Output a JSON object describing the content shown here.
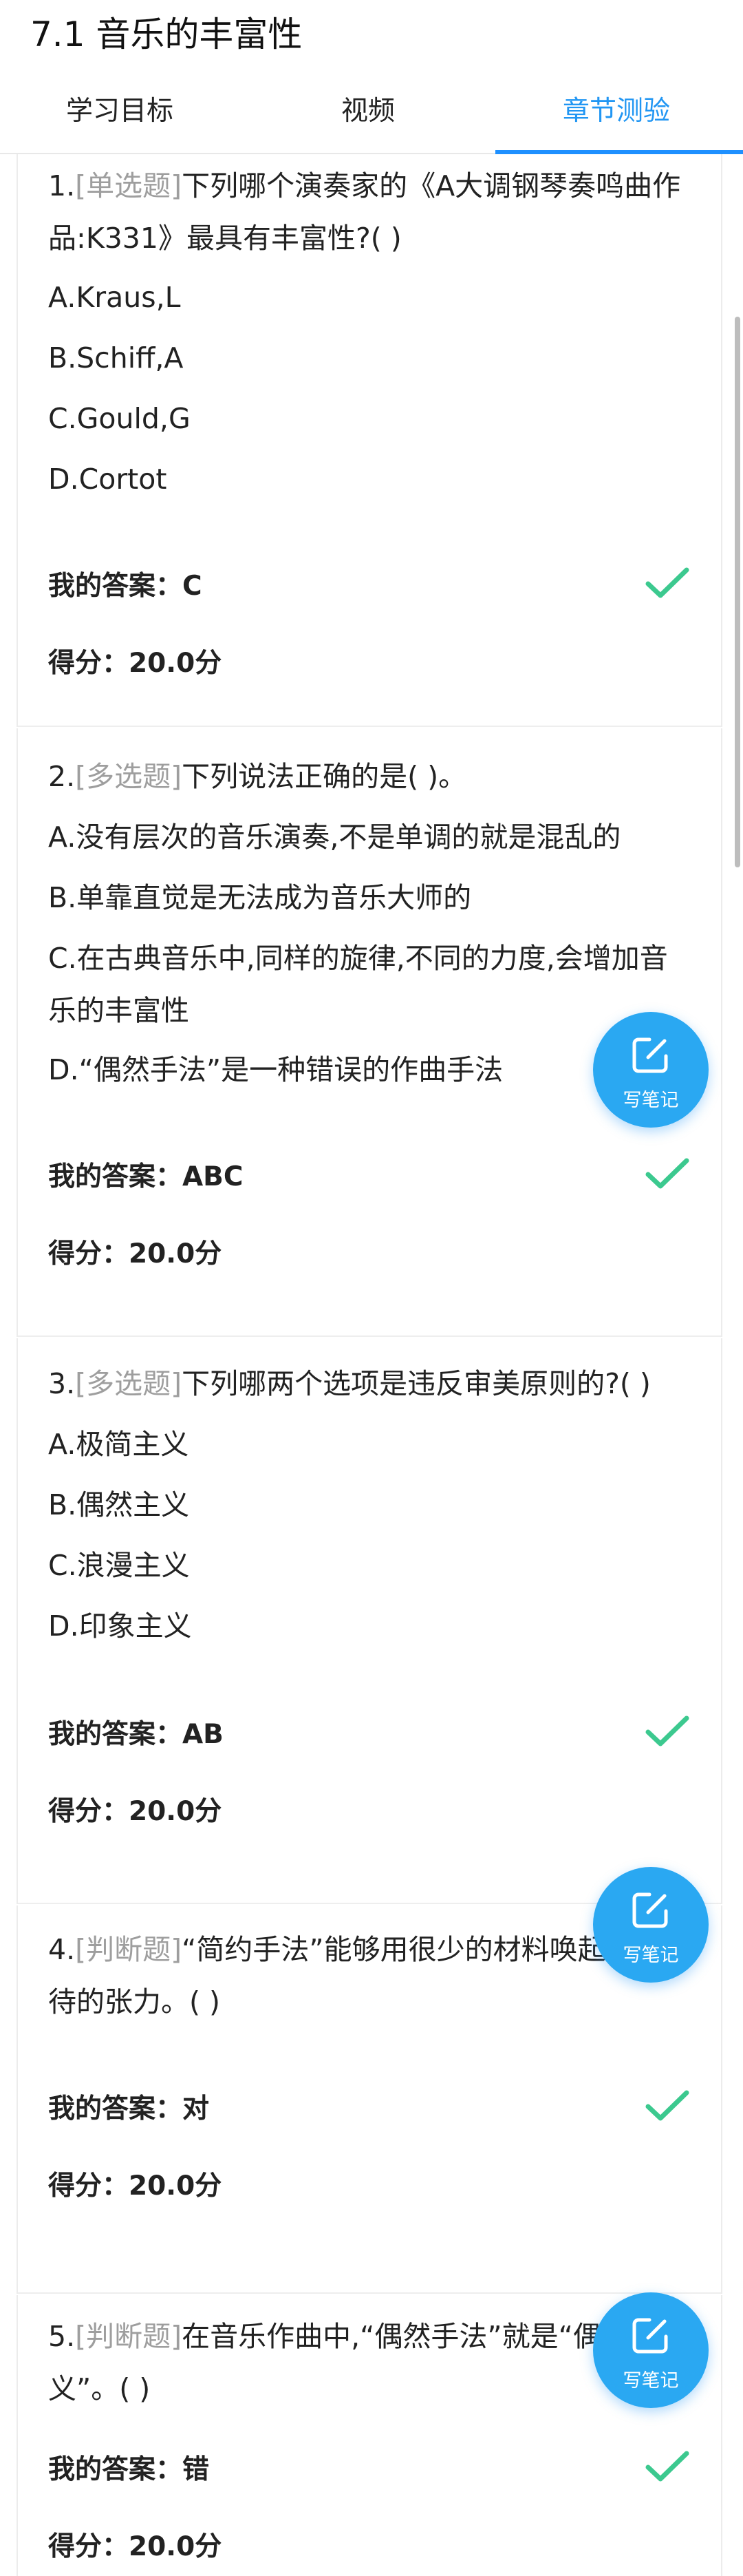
{
  "page_title": "7.1 音乐的丰富性",
  "tabs": [
    {
      "label": "学习目标"
    },
    {
      "label": "视频"
    },
    {
      "label": "章节测验"
    }
  ],
  "questions": [
    {
      "num": "1.",
      "type": "[单选题]",
      "text": "下列哪个演奏家的《A大调钢琴奏鸣曲作品:K331》最具有丰富性?( )",
      "options": [
        "A.Kraus,L",
        "B.Schiff,A",
        "C.Gould,G",
        "D.Cortot"
      ],
      "answer": "我的答案：C",
      "score": "得分：20.0分"
    },
    {
      "num": "2.",
      "type": "[多选题]",
      "text": "下列说法正确的是( )。",
      "options": [
        "A.没有层次的音乐演奏,不是单调的就是混乱的",
        "B.单靠直觉是无法成为音乐大师的",
        "C.在古典音乐中,同样的旋律,不同的力度,会增加音乐的丰富性",
        "D.“偶然手法”是一种错误的作曲手法"
      ],
      "answer": "我的答案：ABC",
      "score": "得分：20.0分"
    },
    {
      "num": "3.",
      "type": "[多选题]",
      "text": "下列哪两个选项是违反审美原则的?( )",
      "options": [
        "A.极简主义",
        "B.偶然主义",
        "C.浪漫主义",
        "D.印象主义"
      ],
      "answer": "我的答案：AB",
      "score": "得分：20.0分"
    },
    {
      "num": "4.",
      "type": "[判断题]",
      "text": "“简约手法”能够用很少的材料唤起听众期待的张力。( )",
      "options": [],
      "answer": "我的答案：对",
      "score": "得分：20.0分"
    },
    {
      "num": "5.",
      "type": "[判断题]",
      "text": "在音乐作曲中,“偶然手法”就是“偶然主义”。( )",
      "options": [],
      "answer": "我的答案：错",
      "score": "得分：20.0分"
    }
  ],
  "fab": {
    "label": "写笔记"
  },
  "colors": {
    "accent": "#1e90ff",
    "check": "#3cc98f",
    "fab": "#2aa8f2",
    "type_label": "#9e9e9e"
  }
}
